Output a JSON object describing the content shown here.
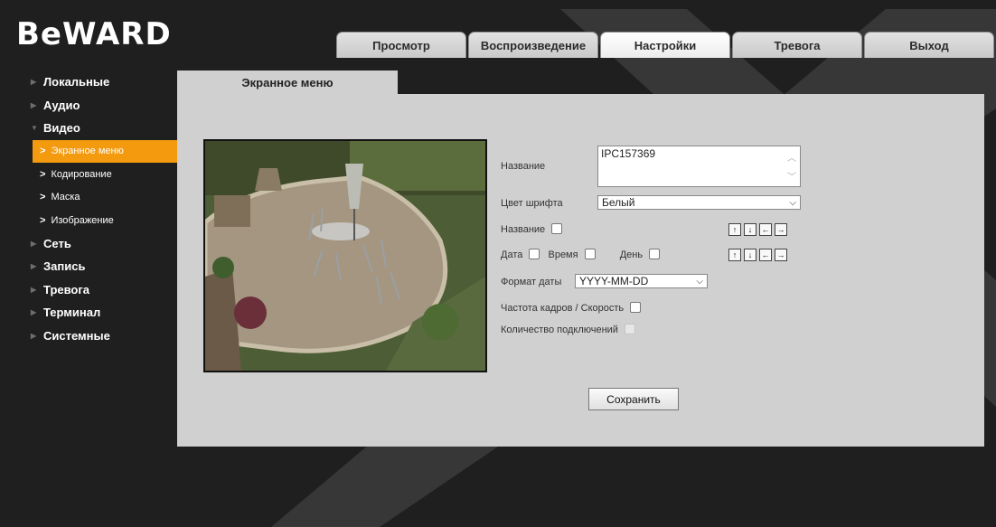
{
  "logo": "BeWARD",
  "tabs": [
    "Просмотр",
    "Воспроизведение",
    "Настройки",
    "Тревога",
    "Выход"
  ],
  "sidebar": {
    "items": [
      {
        "label": "Локальные",
        "icon": "triangle-right-icon"
      },
      {
        "label": "Аудио",
        "icon": "triangle-right-icon"
      },
      {
        "label": "Видео",
        "icon": "triangle-down-icon"
      },
      {
        "label": "Экранное меню",
        "sub": true,
        "active": true
      },
      {
        "label": "Кодирование",
        "sub": true
      },
      {
        "label": "Маска",
        "sub": true
      },
      {
        "label": "Изображение",
        "sub": true
      },
      {
        "label": "Сеть",
        "icon": "triangle-right-icon"
      },
      {
        "label": "Запись",
        "icon": "triangle-right-icon"
      },
      {
        "label": "Тревога",
        "icon": "triangle-right-icon"
      },
      {
        "label": "Терминал",
        "icon": "triangle-right-icon"
      },
      {
        "label": "Системные",
        "icon": "triangle-right-icon"
      }
    ]
  },
  "content_tab": "Экранное меню",
  "form": {
    "name_label": "Название",
    "name_value": "IPC157369",
    "font_color_label": "Цвет шрифта",
    "font_color_value": "Белый",
    "show_name_label": "Название",
    "date_label": "Дата",
    "time_label": "Время",
    "day_label": "День",
    "date_format_label": "Формат даты",
    "date_format_value": "YYYY-MM-DD",
    "fps_label": "Частота кадров / Скорость",
    "connections_label": "Количество подключений",
    "save_label": "Сохранить"
  },
  "arrow_symbols": [
    "↑",
    "↓",
    "←",
    "→"
  ],
  "colors": {
    "accent": "#f39a0f",
    "panel": "#d0d0d0",
    "background": "#1f1f1f"
  }
}
